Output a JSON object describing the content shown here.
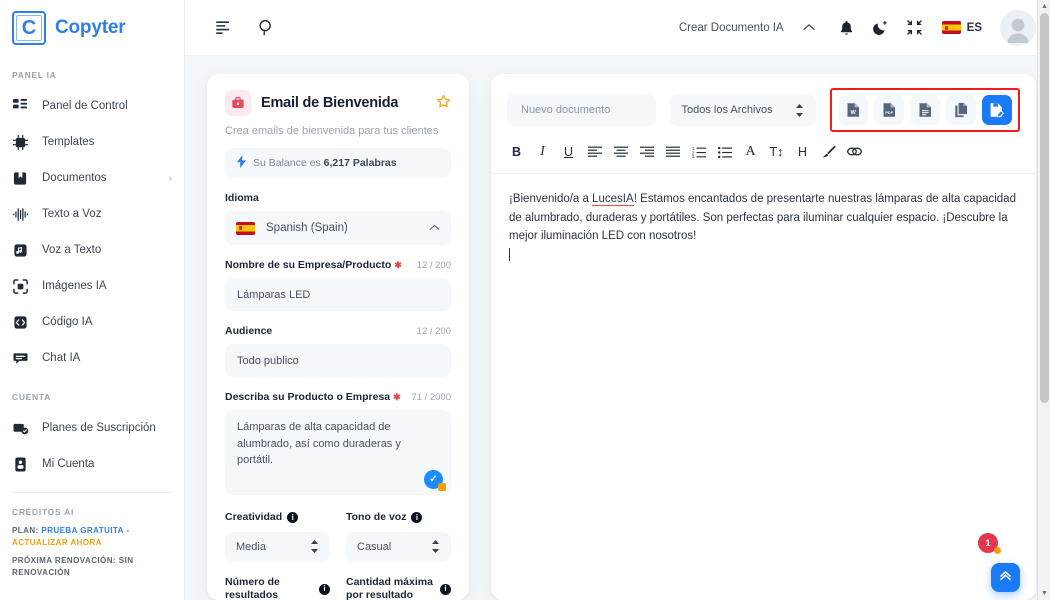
{
  "brand": {
    "mark": "C",
    "name": "Copyter"
  },
  "sidebar": {
    "section_panel_title": "PANEL IA",
    "section_account_title": "CUENTA",
    "section_credits_title": "CRÉDITOS AI",
    "panel_items": [
      {
        "label": "Panel de Control",
        "icon": "dashboard-icon",
        "caret": ""
      },
      {
        "label": "Templates",
        "icon": "chip-ai-icon",
        "caret": ""
      },
      {
        "label": "Documentos",
        "icon": "documents-icon",
        "caret": "›"
      },
      {
        "label": "Texto a Voz",
        "icon": "waveform-icon",
        "caret": ""
      },
      {
        "label": "Voz a Texto",
        "icon": "audio-file-icon",
        "caret": ""
      },
      {
        "label": "Imágenes IA",
        "icon": "image-ai-icon",
        "caret": ""
      },
      {
        "label": "Código IA",
        "icon": "code-icon",
        "caret": ""
      },
      {
        "label": "Chat IA",
        "icon": "chat-icon",
        "caret": ""
      }
    ],
    "account_items": [
      {
        "label": "Planes de Suscripción",
        "icon": "subscription-icon"
      },
      {
        "label": "Mi Cuenta",
        "icon": "account-card-icon"
      }
    ],
    "credits": {
      "plan_prefix": "PLAN:",
      "plan_value": "PRUEBA GRATUITA",
      "plan_separator": "-",
      "plan_action": "ACTUALIZAR AHORA",
      "renewal": "PRÓXIMA RENOVACIÓN: SIN RENOVACIÓN"
    }
  },
  "topbar": {
    "menu_icon": "menu-align-icon",
    "search_icon": "search-icon",
    "create_doc_label": "Crear Documento IA",
    "chevron": "⌃",
    "bell_icon": "bell-icon",
    "theme_icon": "moon-dark-mode-icon",
    "fullscreen_icon": "collapse-screen-icon",
    "language_code": "ES",
    "avatar_icon": "user-avatar-icon"
  },
  "form": {
    "badge_icon": "briefcase-icon",
    "title": "Email de Bienvenida",
    "star_icon": "star-favorite-icon",
    "subtitle": "Crea emails de bienvenida para tus clientes",
    "balance_prefix": "Su Balance es",
    "balance_value": "6,217 Palabras",
    "language_label": "Idioma",
    "language_value": "Spanish (Spain)",
    "company_label": "Nombre de su Empresa/Producto",
    "company_count": "12 / 200",
    "company_value": "Lámparas LED",
    "audience_label": "Audience",
    "audience_count": "12 / 200",
    "audience_value": "Todo publico",
    "describe_label": "Describa su Producto o Empresa",
    "describe_count": "71 / 2000",
    "describe_value": "Lámparas de alta capacidad de alumbrado, así como duraderas y portátil.",
    "creativity_label": "Creatividad",
    "creativity_value": "Media",
    "tone_label": "Tono de voz",
    "tone_value": "Casual",
    "results_label": "Número de resultados",
    "max_per_result_label": "Cantidad máxima por resultado"
  },
  "editor": {
    "name_placeholder": "Nuevo documento",
    "filter_value": "Todos los Archivos",
    "actions": [
      {
        "name": "export-word-button",
        "icon": "word-doc-icon",
        "label": "W"
      },
      {
        "name": "export-pdf-button",
        "icon": "pdf-doc-icon",
        "label": "PDF"
      },
      {
        "name": "export-text-button",
        "icon": "text-doc-icon",
        "label": ""
      },
      {
        "name": "copy-document-button",
        "icon": "copy-icon",
        "label": ""
      },
      {
        "name": "save-document-button",
        "icon": "save-doc-icon",
        "label": ""
      }
    ],
    "toolbar": [
      {
        "name": "bold-button",
        "glyph": "B",
        "cls": "bold"
      },
      {
        "name": "italic-button",
        "glyph": "I",
        "cls": "ital"
      },
      {
        "name": "underline-button",
        "glyph": "U",
        "cls": "und"
      },
      {
        "name": "align-left-button",
        "glyph": "align-left-icon",
        "cls": "svg"
      },
      {
        "name": "align-center-button",
        "glyph": "align-center-icon",
        "cls": "svg"
      },
      {
        "name": "align-right-button",
        "glyph": "align-right-icon",
        "cls": "svg"
      },
      {
        "name": "align-justify-button",
        "glyph": "align-justify-icon",
        "cls": "svg"
      },
      {
        "name": "ordered-list-button",
        "glyph": "ordered-list-icon",
        "cls": "svg"
      },
      {
        "name": "bullet-list-button",
        "glyph": "bullet-list-icon",
        "cls": "svg"
      },
      {
        "name": "font-color-button",
        "glyph": "A",
        "cls": "serifA"
      },
      {
        "name": "font-size-button",
        "glyph": "T↕",
        "cls": ""
      },
      {
        "name": "heading-button",
        "glyph": "H",
        "cls": ""
      },
      {
        "name": "highlight-button",
        "glyph": "brush-icon",
        "cls": "svg"
      },
      {
        "name": "link-button",
        "glyph": "link-icon",
        "cls": "svg"
      }
    ],
    "document_text_part1": "¡Bienvenido/a a ",
    "document_text_spell": "LucesIA",
    "document_text_part2": "! Estamos encantados de presentarte nuestras lámparas de alta capacidad de alumbrado, duraderas y portátiles. Son perfectas para iluminar cualquier espacio. ¡Descubre la mejor iluminación LED con nosotros!"
  },
  "floating": {
    "notification_count": "1",
    "scroll_top_icon": "double-chevron-up-icon"
  },
  "colors": {
    "brand_blue": "#2f7fe8",
    "primary_blue": "#1a7bf5",
    "accent_orange": "#f59e0b",
    "danger_red": "#e5484d",
    "highlight_border": "#f31c1c"
  }
}
